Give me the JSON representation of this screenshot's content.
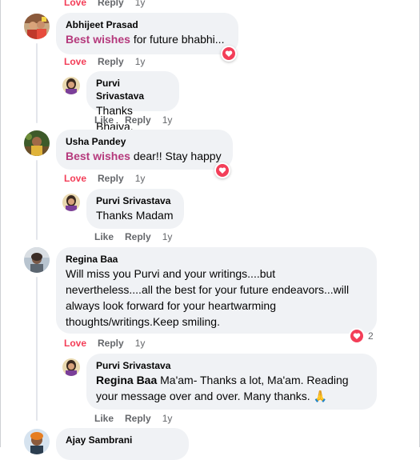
{
  "top_actions": {
    "love": "Love",
    "reply": "Reply",
    "time": "1y"
  },
  "comments": [
    {
      "author": "Abhijeet Prasad",
      "highlight": "Best wishes",
      "text": " for future bhabhi...",
      "actions": {
        "love": "Love",
        "reply": "Reply",
        "time": "1y"
      },
      "reaction": "heart",
      "reply": {
        "author": "Purvi Srivastava",
        "text": "Thanks Bhaiya.",
        "actions": {
          "like": "Like",
          "reply": "Reply",
          "time": "1y"
        }
      }
    },
    {
      "author": "Usha Pandey",
      "highlight": "Best wishes",
      "text": " dear!! Stay happy",
      "actions": {
        "love": "Love",
        "reply": "Reply",
        "time": "1y"
      },
      "reaction": "heart",
      "reply": {
        "author": "Purvi Srivastava",
        "text": "Thanks Madam",
        "actions": {
          "like": "Like",
          "reply": "Reply",
          "time": "1y"
        }
      }
    },
    {
      "author": "Regina Baa",
      "text_lines": [
        "Will miss you Purvi and your writings....but",
        "nevertheless....all the best for your future endeavors...will",
        "always look forward for your heartwarming",
        "thoughts/writings.Keep smiling."
      ],
      "actions": {
        "love": "Love",
        "reply": "Reply",
        "time": "1y"
      },
      "reaction": "heart",
      "reaction_count": "2",
      "reply": {
        "author": "Purvi Srivastava",
        "mention": "Regina Baa",
        "text_line1": " Ma'am- Thanks a lot, Ma'am. Reading",
        "text_line2": "your message over and over. Many thanks. ",
        "emoji": "🙏",
        "actions": {
          "like": "Like",
          "reply": "Reply",
          "time": "1y"
        }
      }
    },
    {
      "author": "Ajay Sambrani"
    }
  ],
  "colors": {
    "love": "#f33e58",
    "highlight": "#b5397c",
    "bubble": "#f0f2f5",
    "meta": "#65676b"
  }
}
